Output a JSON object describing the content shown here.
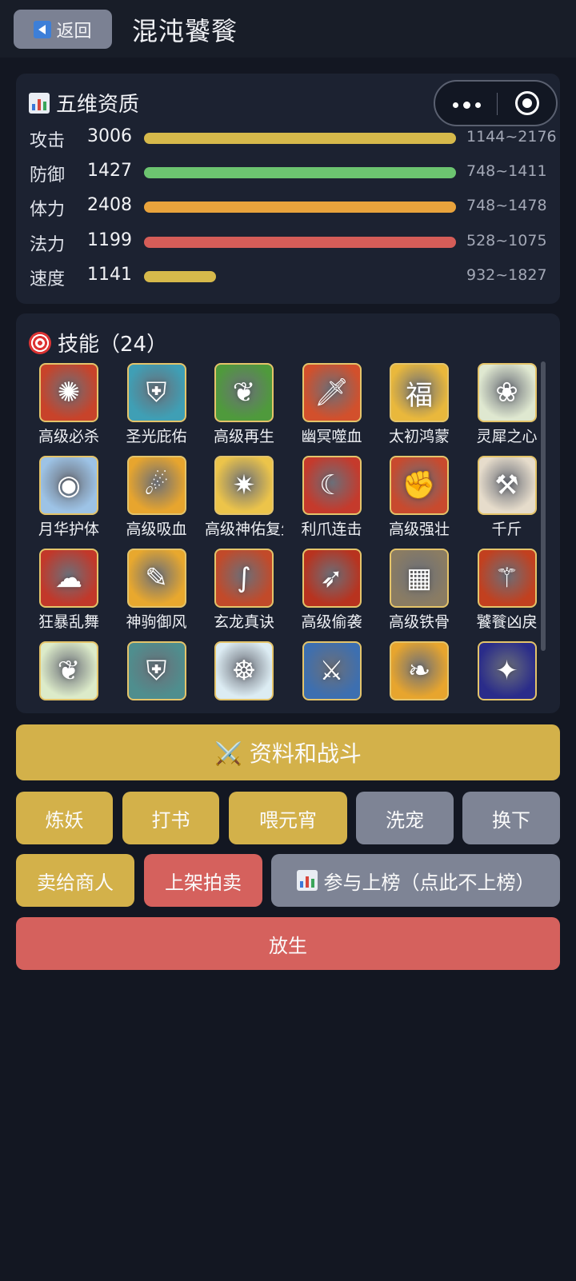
{
  "header": {
    "back_label": "返回",
    "title": "混沌饕餮"
  },
  "stats": {
    "title": "五维资质",
    "rows": [
      {
        "label": "攻击",
        "value": "3006",
        "range": "1144~2176",
        "fill": 1.0,
        "color": "#d6b94b"
      },
      {
        "label": "防御",
        "value": "1427",
        "range": "748~1411",
        "fill": 1.0,
        "color": "#6cc470"
      },
      {
        "label": "体力",
        "value": "2408",
        "range": "748~1478",
        "fill": 1.0,
        "color": "#e9a33c"
      },
      {
        "label": "法力",
        "value": "1199",
        "range": "528~1075",
        "fill": 1.0,
        "color": "#d55d58"
      },
      {
        "label": "速度",
        "value": "1141",
        "range": "932~1827",
        "fill": 0.23,
        "color": "#d6b94b"
      }
    ]
  },
  "skills": {
    "title": "技能（24）",
    "items": [
      {
        "name": "高级必杀",
        "icon": "firework-burst-icon",
        "glyph": "✺",
        "bg": "#c8432a"
      },
      {
        "name": "圣光庇佑",
        "icon": "shield-icon",
        "glyph": "⛨",
        "bg": "#3f9fb5"
      },
      {
        "name": "高级再生",
        "icon": "leaf-icon",
        "glyph": "❦",
        "bg": "#4f9a3c"
      },
      {
        "name": "幽冥噬血",
        "icon": "dagger-icon",
        "glyph": "🗡",
        "bg": "#d2502c"
      },
      {
        "name": "太初鸿蒙",
        "icon": "golden-rune-icon",
        "glyph": "福",
        "bg": "#e9b83c"
      },
      {
        "name": "灵犀之心",
        "icon": "feather-wreath-icon",
        "glyph": "❀",
        "bg": "#dfe8d0"
      },
      {
        "name": "月华护体",
        "icon": "moon-orb-icon",
        "glyph": "◉",
        "bg": "#9dc3e6"
      },
      {
        "name": "高级吸血",
        "icon": "flail-icon",
        "glyph": "☄",
        "bg": "#e7a52e"
      },
      {
        "name": "高级神佑复生",
        "icon": "holy-light-icon",
        "glyph": "✷",
        "bg": "#ecc44a"
      },
      {
        "name": "利爪连击",
        "icon": "claw-icon",
        "glyph": "☾",
        "bg": "#c53a2c"
      },
      {
        "name": "高级强壮",
        "icon": "gauntlet-icon",
        "glyph": "✊",
        "bg": "#c84a2e"
      },
      {
        "name": "千斤",
        "icon": "axe-icon",
        "glyph": "⚒",
        "bg": "#e6dccb"
      },
      {
        "name": "狂暴乱舞",
        "icon": "fury-swirl-icon",
        "glyph": "☁",
        "bg": "#c2382a"
      },
      {
        "name": "神驹御风",
        "icon": "brush-icon",
        "glyph": "✎",
        "bg": "#e8a82e"
      },
      {
        "name": "玄龙真诀",
        "icon": "staff-icon",
        "glyph": "∫",
        "bg": "#c24a2a"
      },
      {
        "name": "高级偷袭",
        "icon": "flame-spear-icon",
        "glyph": "➶",
        "bg": "#b8331f"
      },
      {
        "name": "高级铁骨",
        "icon": "chained-wall-icon",
        "glyph": "▦",
        "bg": "#8a7c63"
      },
      {
        "name": "饕餮凶戾",
        "icon": "trident-icon",
        "glyph": "⚚",
        "bg": "#c2401f"
      },
      {
        "name": "",
        "icon": "leaf-icon",
        "glyph": "❦",
        "bg": "#dcebc9"
      },
      {
        "name": "",
        "icon": "shield-icon",
        "glyph": "⛨",
        "bg": "#4f8e8e"
      },
      {
        "name": "",
        "icon": "meditation-icon",
        "glyph": "☸",
        "bg": "#dcecf3"
      },
      {
        "name": "",
        "icon": "crossed-swords-icon",
        "glyph": "⚔",
        "bg": "#3d6fb0"
      },
      {
        "name": "",
        "icon": "wing-icon",
        "glyph": "❧",
        "bg": "#e7a52e"
      },
      {
        "name": "",
        "icon": "star-night-icon",
        "glyph": "✦",
        "bg": "#2a2c8a"
      }
    ]
  },
  "actions": {
    "info_battle": "⚔️ 资料和战斗",
    "refine": "炼妖",
    "book": "打书",
    "feed": "喂元宵",
    "wash": "洗宠",
    "swap": "换下",
    "sell": "卖给商人",
    "auction": "上架拍卖",
    "rank": "参与上榜（点此不上榜）",
    "release": "放生"
  }
}
